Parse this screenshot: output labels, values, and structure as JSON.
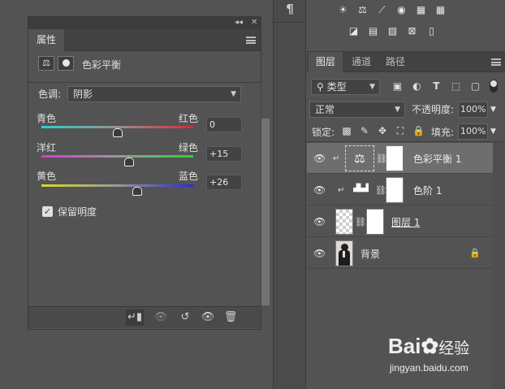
{
  "properties_panel": {
    "collapse_glyph": "◂◂",
    "close_glyph": "✕",
    "tab_label": "属性",
    "header_title": "色彩平衡",
    "header_icon": "balance-scale-icon",
    "tone_label": "色调:",
    "tone_value": "阴影",
    "sliders": [
      {
        "left_label": "青色",
        "right_label": "红色",
        "value": "0",
        "gradient": [
          "#2bd0d0",
          "#9a8f8f",
          "#d62b3a"
        ],
        "thumb_fraction": 0.5
      },
      {
        "left_label": "洋红",
        "right_label": "绿色",
        "value": "+15",
        "gradient": [
          "#d43ad4",
          "#999999",
          "#2bd43a"
        ],
        "thumb_fraction": 0.575
      },
      {
        "left_label": "黄色",
        "right_label": "蓝色",
        "value": "+26",
        "gradient": [
          "#d8d82b",
          "#999999",
          "#2b2bd4"
        ],
        "thumb_fraction": 0.63
      }
    ],
    "preserve_luminosity_label": "保留明度",
    "preserve_luminosity_checked": true
  },
  "adjustment_icons": {
    "row1": [
      "brightness-contrast-icon",
      "levels-icon",
      "curves-icon",
      "exposure-icon",
      "vibrance-icon"
    ],
    "row2": [
      "invert-icon",
      "posterize-icon",
      "threshold-icon",
      "selective-color-icon",
      "gradient-map-icon"
    ],
    "row1_glyphs": [
      "☀",
      "⚖",
      "⟋",
      "◉",
      "▦"
    ],
    "row2_glyphs": [
      "◪",
      "▤",
      "▨",
      "⊠",
      "▯"
    ]
  },
  "layers_panel": {
    "tabs": [
      "图层",
      "通道",
      "路径"
    ],
    "active_tab": 0,
    "filter_value": "类型",
    "blend_mode": "正常",
    "opacity_label": "不透明度:",
    "opacity_value": "100%",
    "lock_label": "锁定:",
    "fill_label": "填充:",
    "fill_value": "100%",
    "layers": [
      {
        "name": "色彩平衡 1",
        "type": "adjustment",
        "glyph": "⚖",
        "selected": true,
        "clipped": true
      },
      {
        "name": "色阶 1",
        "type": "adjustment",
        "glyph": "▟▙▟",
        "selected": false,
        "clipped": true
      },
      {
        "name": "图层 1",
        "type": "pixel",
        "selected": false,
        "clipped": false
      },
      {
        "name": "背景",
        "type": "background",
        "selected": false,
        "clipped": false,
        "locked": true
      }
    ]
  },
  "watermark": {
    "brand": "Bai",
    "brand_suffix": "经验",
    "url": "jingyan.baidu.com"
  },
  "colors": {
    "panel_bg": "#535353",
    "selected_row": "#6e6e6e",
    "dark_bar": "#424242"
  }
}
